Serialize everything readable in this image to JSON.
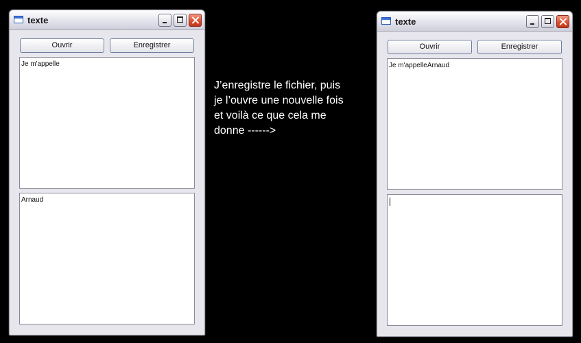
{
  "left_window": {
    "title": "texte",
    "open_label": "Ouvrir",
    "save_label": "Enregistrer",
    "text_top": "Je m'appelle",
    "text_bottom": "Arnaud"
  },
  "right_window": {
    "title": "texte",
    "open_label": "Ouvrir",
    "save_label": "Enregistrer",
    "text_top": "Je m'appelleArnaud",
    "text_bottom": ""
  },
  "caption": "J’enregistre le fichier, puis\nje l’ouvre une nouvelle fois\net voilà ce que cela me\ndonne ------>",
  "colors": {
    "background": "#000000",
    "window_frame": "#e6e6ec",
    "close_button": "#d94a2a",
    "caption_text": "#ffffff"
  }
}
